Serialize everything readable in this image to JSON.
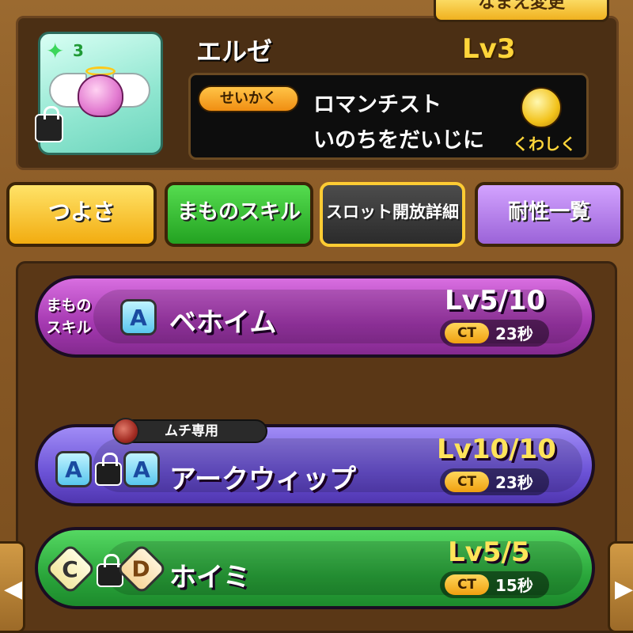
{
  "header": {
    "rename_button": "なまえ変更",
    "star_count": "3",
    "character_name": "エルゼ",
    "level": "Lv3"
  },
  "personality": {
    "tag": "せいかく",
    "line1": "ロマンチスト",
    "line2": "いのちをだいじに",
    "detail_label": "くわしく"
  },
  "tabs": [
    {
      "label": "つよさ"
    },
    {
      "label": "まものスキル"
    },
    {
      "label": "スロット開放詳細"
    },
    {
      "label": "耐性一覧"
    }
  ],
  "skills": [
    {
      "category": "まもの\nスキル",
      "rank": "A",
      "name": "ベホイム",
      "level": "Lv5/10",
      "ct_label": "CT",
      "ct_value": "23秒"
    },
    {
      "tag": "ムチ専用",
      "rank_left": "A",
      "rank_right": "A",
      "name": "アークウィップ",
      "level": "Lv10/10",
      "ct_label": "CT",
      "ct_value": "23秒"
    },
    {
      "rank_left": "C",
      "rank_right": "D",
      "name": "ホイミ",
      "level": "Lv5/5",
      "ct_label": "CT",
      "ct_value": "15秒"
    }
  ],
  "icons": {
    "star": "sparkle-icon",
    "lock": "lock-icon",
    "detail": "magnifier-icon",
    "whip": "whip-icon",
    "arrow_left": "arrow-left-icon",
    "arrow_right": "arrow-right-icon"
  },
  "colors": {
    "gold": "#ffd53a",
    "purple_card": "#a438b0",
    "violet_card": "#6b52d6",
    "green_card": "#2aa63b"
  }
}
